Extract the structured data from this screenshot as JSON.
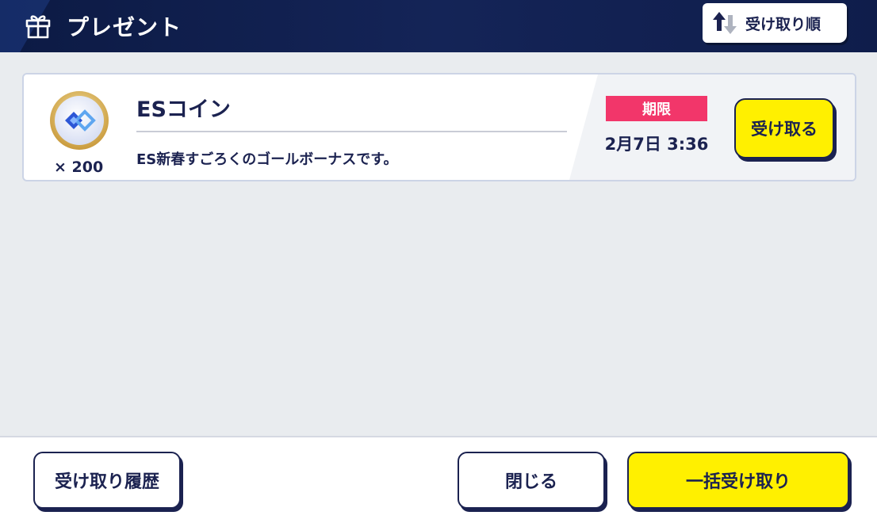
{
  "header": {
    "title": "プレゼント",
    "icon": "gift-icon",
    "sort_button": {
      "label": "受け取り順",
      "icon": "sort-arrows-icon"
    }
  },
  "presents": [
    {
      "name": "ESコイン",
      "icon": "es-coin-icon",
      "quantity": "× 200",
      "description": "ES新春すごろくのゴールボーナスです。",
      "limit_label": "期限",
      "limit_date": "2月7日 3:36",
      "receive_label": "受け取る"
    }
  ],
  "footer": {
    "history_label": "受け取り履歴",
    "close_label": "閉じる",
    "bulk_receive_label": "一括受け取り"
  },
  "colors": {
    "header_bg": "#142457",
    "accent_yellow": "#fff000",
    "limit_badge": "#f2366a",
    "text_navy": "#1b2250",
    "page_bg": "#e9ecef"
  }
}
